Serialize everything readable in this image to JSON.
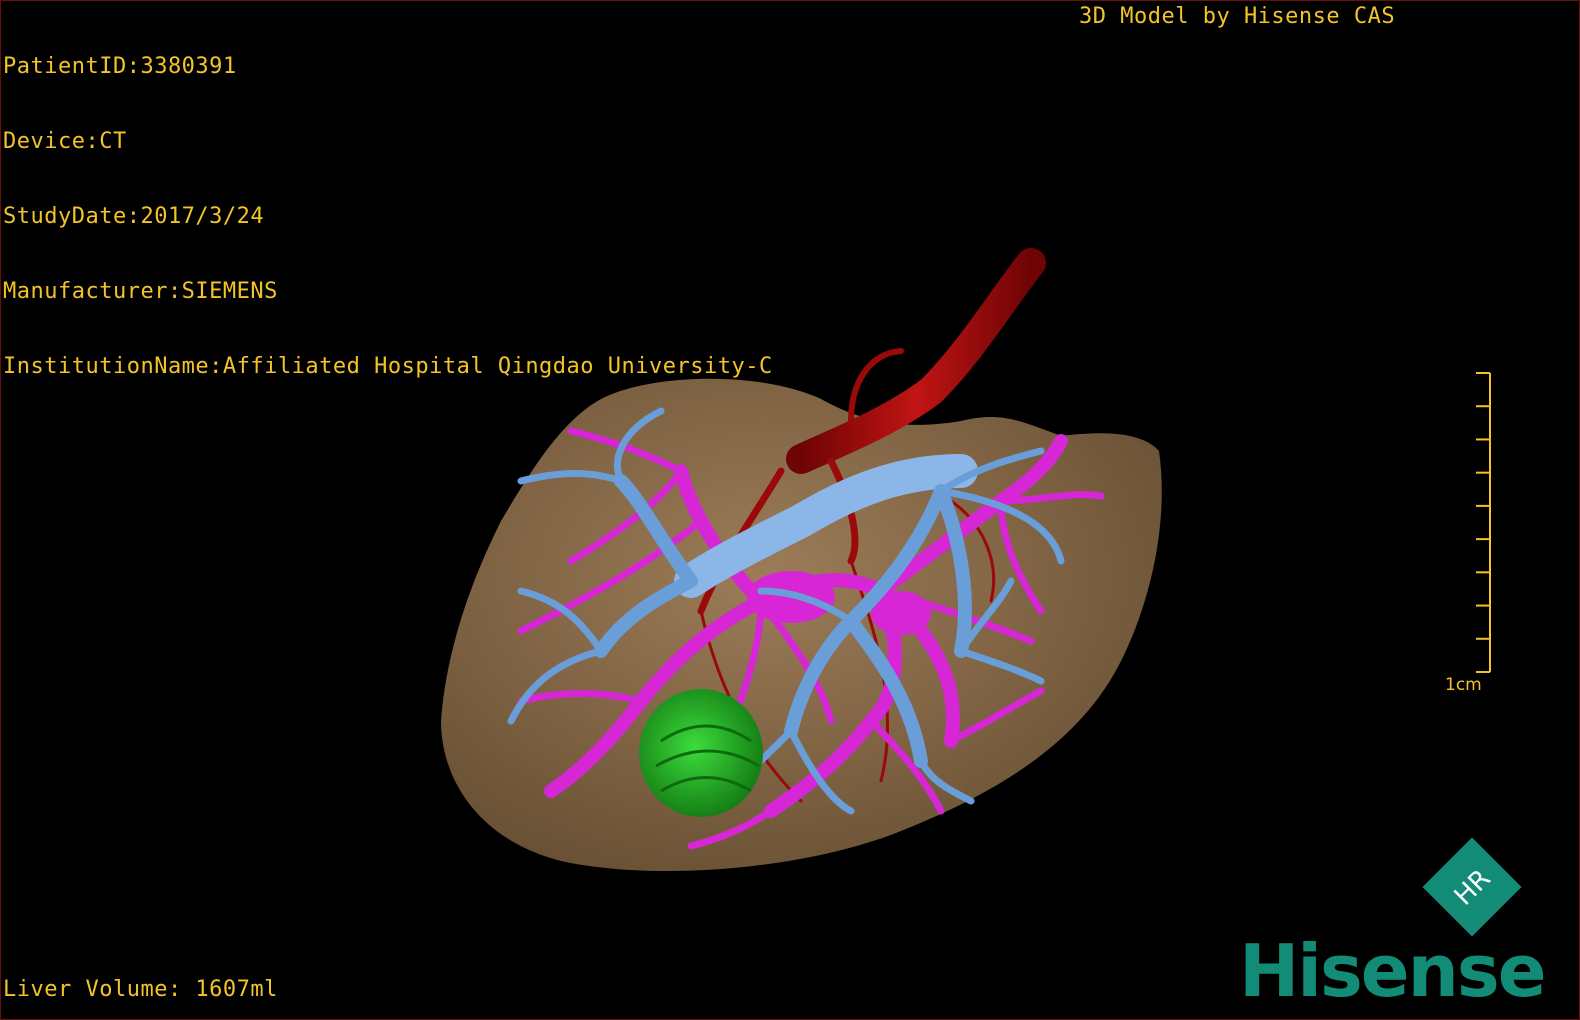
{
  "colors": {
    "overlay_text": "#f2c42a",
    "scale": "#f2c42a",
    "liver": "#8c6e4d",
    "artery": "#a20a0a",
    "hepatic_vein": "#6a9ed8",
    "portal_vein": "#d626d6",
    "gallbladder": "#20b020",
    "brand": "#128c77"
  },
  "patient_info": [
    "PatientID:3380391",
    "Device:CT",
    "StudyDate:2017/3/24",
    "Manufacturer:SIEMENS",
    "InstitutionName:Affiliated Hospital Qingdao University-C"
  ],
  "model_credit": "3D Model by Hisense CAS",
  "volume_text": "Liver Volume: 1607ml",
  "scale": {
    "label": "1cm",
    "divisions": 9
  },
  "logo": {
    "monogram": "HR",
    "wordmark": "Hisense"
  },
  "structures": [
    "liver",
    "artery",
    "hepatic_vein",
    "portal_vein",
    "gallbladder"
  ]
}
